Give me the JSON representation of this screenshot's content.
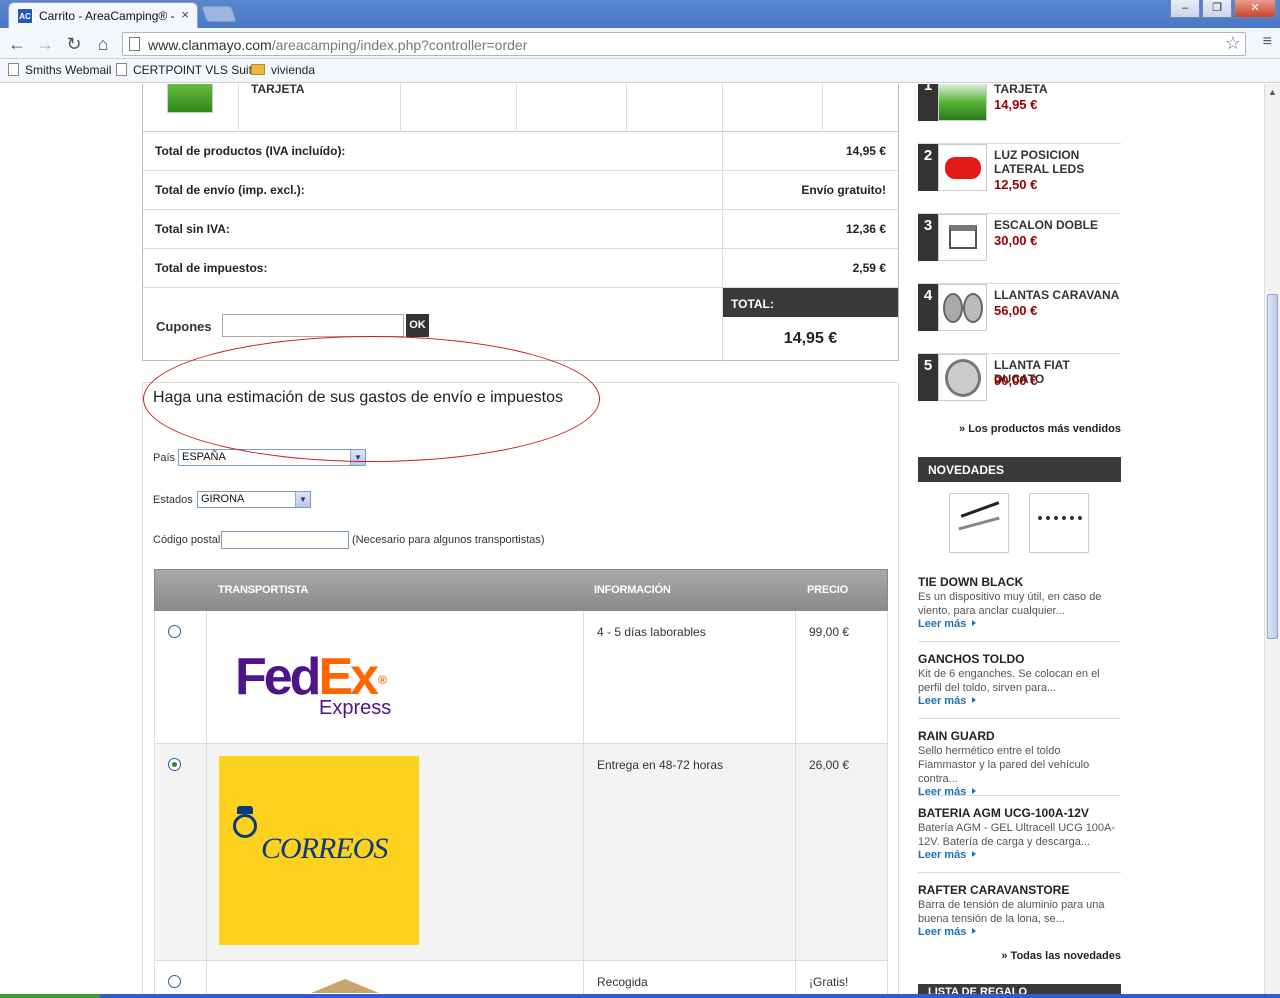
{
  "browser": {
    "tab_title": "Carrito - AreaCamping® - Ac",
    "favicon_text": "AC",
    "url_host": "www.clanmayo.com",
    "url_path": "/areacamping/index.php?controller=order",
    "bookmarks": [
      "Smiths Webmail",
      "CERTPOINT VLS Suite",
      "vivienda"
    ]
  },
  "cart": {
    "product_name": "TARJETA",
    "summary": [
      {
        "label": "Total de productos (IVA incluído):",
        "value": "14,95 €"
      },
      {
        "label": "Total de envío (imp. excl.):",
        "value": "Envío gratuito!"
      },
      {
        "label": "Total sin IVA:",
        "value": "12,36 €"
      },
      {
        "label": "Total de impuestos:",
        "value": "2,59 €"
      }
    ],
    "coupon_label": "Cupones",
    "coupon_value": "",
    "coupon_button": "OK",
    "total_label": "TOTAL:",
    "total_value": "14,95 €"
  },
  "estimate": {
    "title": "Haga una estimación de sus gastos de envío e impuestos",
    "country_label": "País",
    "country_value": "ESPAÑA",
    "state_label": "Estados",
    "state_value": "GIRONA",
    "postal_label": "Código postal",
    "postal_value": "",
    "postal_note": "(Necesario para algunos transportistas)",
    "headers": {
      "carrier": "TRANSPORTISTA",
      "info": "INFORMACIÓN",
      "price": "PRECIO"
    },
    "carriers": [
      {
        "logo": "FedEx Express",
        "info": "4 - 5 días laborables",
        "price": "99,00 €",
        "selected": false
      },
      {
        "logo": "CORREOS",
        "info": "Entrega en 48-72 horas",
        "price": "26,00 €",
        "selected": true
      },
      {
        "logo": "",
        "info": "Recogida",
        "price": "¡Gratis!",
        "selected": false
      }
    ],
    "logo_text": {
      "fed": "Fed",
      "ex": "Ex",
      "reg": "®",
      "express": "Express",
      "correos": "CORREOS"
    }
  },
  "sidebar": {
    "bestsellers": [
      {
        "rank": "1",
        "name": "GUIA ACSI CON TARJETA",
        "price": "14,95 €"
      },
      {
        "rank": "2",
        "name": "LUZ POSICION LATERAL LEDS",
        "price": "12,50 €"
      },
      {
        "rank": "3",
        "name": "ESCALON DOBLE",
        "price": "30,00 €"
      },
      {
        "rank": "4",
        "name": "LLANTAS CARAVANA",
        "price": "56,00 €"
      },
      {
        "rank": "5",
        "name": "LLANTA FIAT DUCATO",
        "price": "90,00 €"
      }
    ],
    "bestsellers_more": "» Los productos más vendidos",
    "new_heading": "NOVEDADES",
    "news": [
      {
        "title": "TIE DOWN BLACK",
        "desc": "Es un dispositivo muy útil, en caso de viento, para anclar cualquier...",
        "more": "Leer más"
      },
      {
        "title": "GANCHOS TOLDO",
        "desc": "Kit de 6 enganches. Se colocan en el perfil del toldo, sirven para...",
        "more": "Leer más"
      },
      {
        "title": "RAIN GUARD",
        "desc": "Sello hermético entre el toldo Fiammastor y la pared del vehículo contra...",
        "more": "Leer más"
      },
      {
        "title": "BATERIA AGM UCG-100A-12V",
        "desc": "Batería AGM - GEL Ultracell UCG 100A-12V. Batería de carga y descarga...",
        "more": "Leer más"
      },
      {
        "title": "RAFTER CARAVANSTORE",
        "desc": "Barra de tensión de aluminio para una buena tensión de la lona, se...",
        "more": "Leer más"
      }
    ],
    "news_more": "» Todas las novedades",
    "next_heading": "LISTA DE REGALO"
  }
}
